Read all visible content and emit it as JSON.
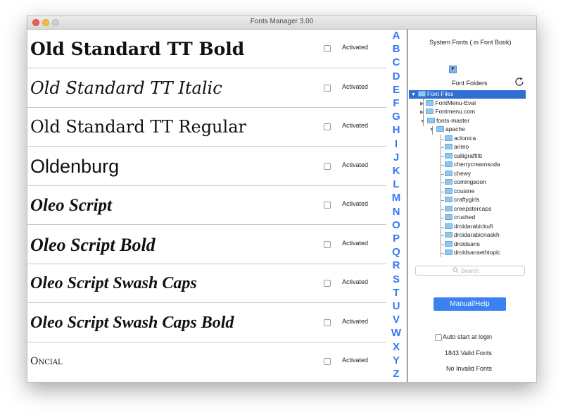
{
  "window": {
    "title": "Fonts Manager 3.00"
  },
  "fonts": [
    {
      "name": "Old Standard TT Bold",
      "status": "Activated"
    },
    {
      "name": "Old Standard TT Italic",
      "status": "Activated"
    },
    {
      "name": "Old Standard TT Regular",
      "status": "Activated"
    },
    {
      "name": "Oldenburg",
      "status": "Activated"
    },
    {
      "name": "Oleo Script",
      "status": "Activated"
    },
    {
      "name": "Oleo Script Bold",
      "status": "Activated"
    },
    {
      "name": "Oleo Script Swash Caps",
      "status": "Activated"
    },
    {
      "name": "Oleo Script Swash Caps Bold",
      "status": "Activated"
    },
    {
      "name": "Oncial",
      "status": "Activated"
    }
  ],
  "alphabet": [
    "A",
    "B",
    "C",
    "D",
    "E",
    "F",
    "G",
    "H",
    "I",
    "J",
    "K",
    "L",
    "M",
    "N",
    "O",
    "P",
    "Q",
    "R",
    "S",
    "T",
    "U",
    "V",
    "W",
    "X",
    "Y",
    "Z"
  ],
  "sidebar": {
    "system_fonts_label": "System Fonts ( in Font Book)",
    "font_book_icon_letter": "F",
    "font_folders_label": "Font Folders",
    "tree": {
      "root": "Font Files",
      "folders": [
        "FontMenu-Eval",
        "Fontmenu.com",
        "fonts-master"
      ],
      "sub_folder": "apache",
      "children": [
        "aclonica",
        "arimo",
        "calligraffitti",
        "cherrycreamsoda",
        "chewy",
        "comingsoon",
        "cousine",
        "craftygirls",
        "creepstercaps",
        "crushed",
        "droidarabickufi",
        "droidarabicnaskh",
        "droidsans",
        "droidsansethiopic"
      ]
    },
    "search_placeholder": "Search",
    "manual_button": "Manual/Help",
    "auto_start_label": "Auto start at login",
    "valid_fonts": "1843 Valid Fonts",
    "invalid_fonts": "No Invalid Fonts"
  },
  "colors": {
    "accent": "#3478f6",
    "selection": "#2f6fd3",
    "button": "#3b82f0"
  }
}
